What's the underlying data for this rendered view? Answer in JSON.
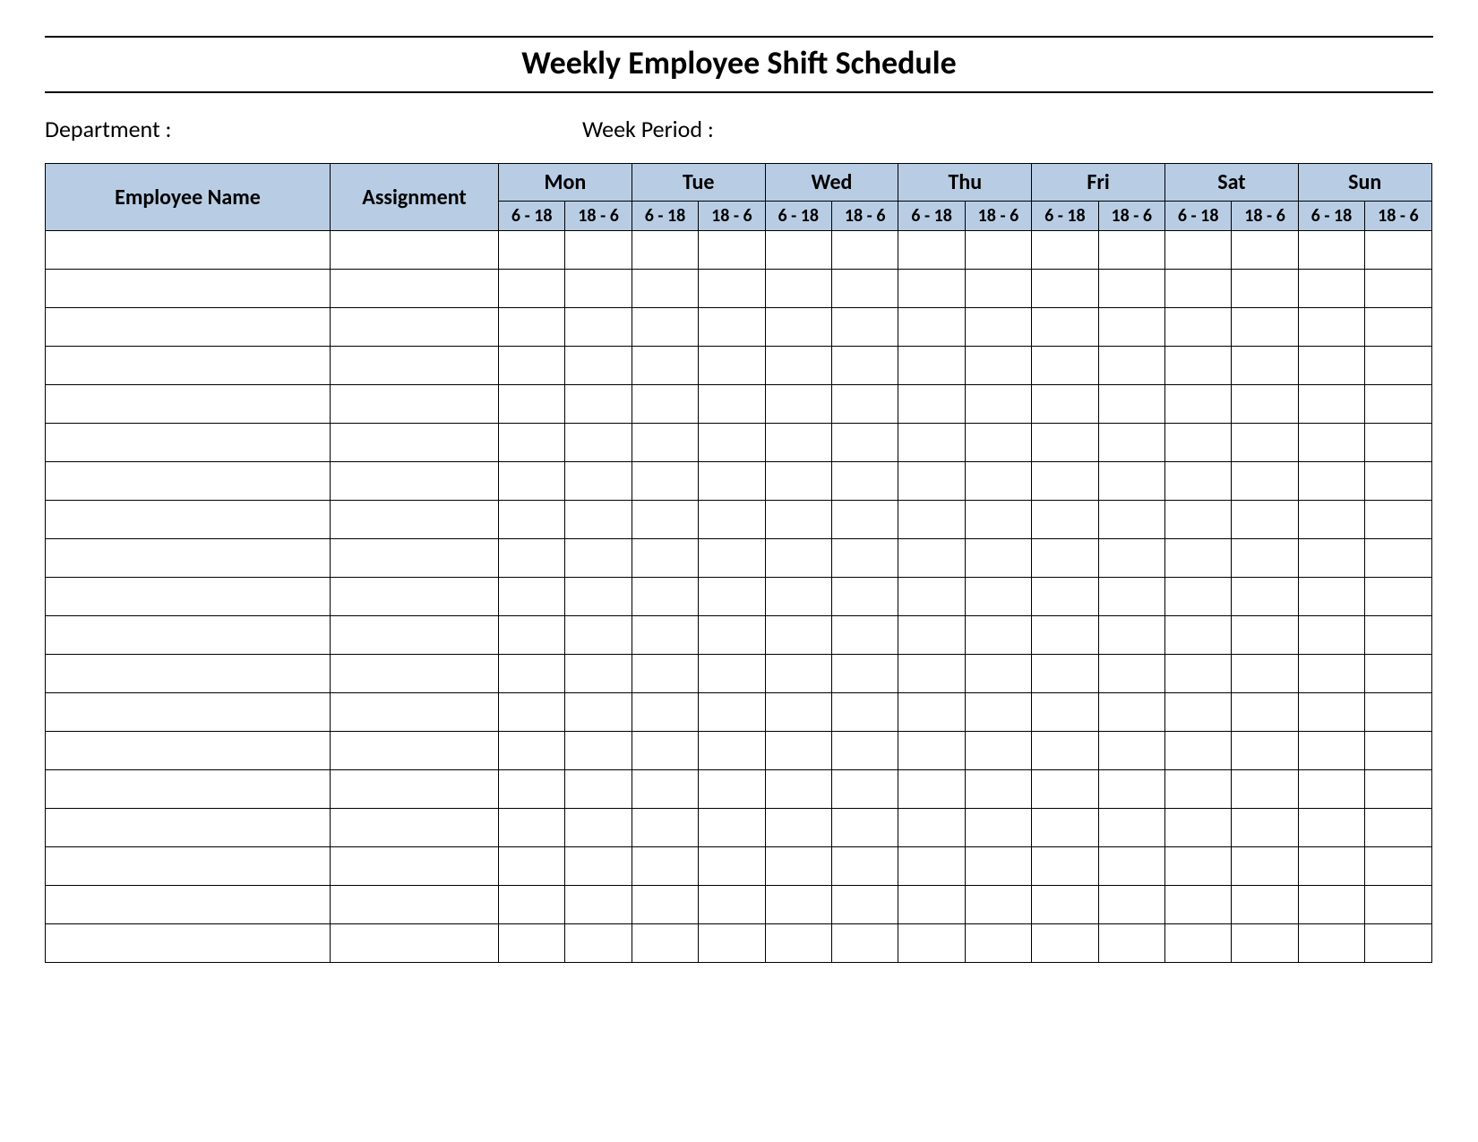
{
  "title": "Weekly Employee Shift Schedule",
  "meta": {
    "department_label": "Department :",
    "week_period_label": "Week  Period :"
  },
  "table": {
    "employee_name_header": "Employee Name",
    "assignment_header": "Assignment",
    "days": [
      "Mon",
      "Tue",
      "Wed",
      "Thu",
      "Fri",
      "Sat",
      "Sun"
    ],
    "shift_labels": [
      "6 - 18",
      "18 - 6"
    ],
    "row_count": 19
  }
}
